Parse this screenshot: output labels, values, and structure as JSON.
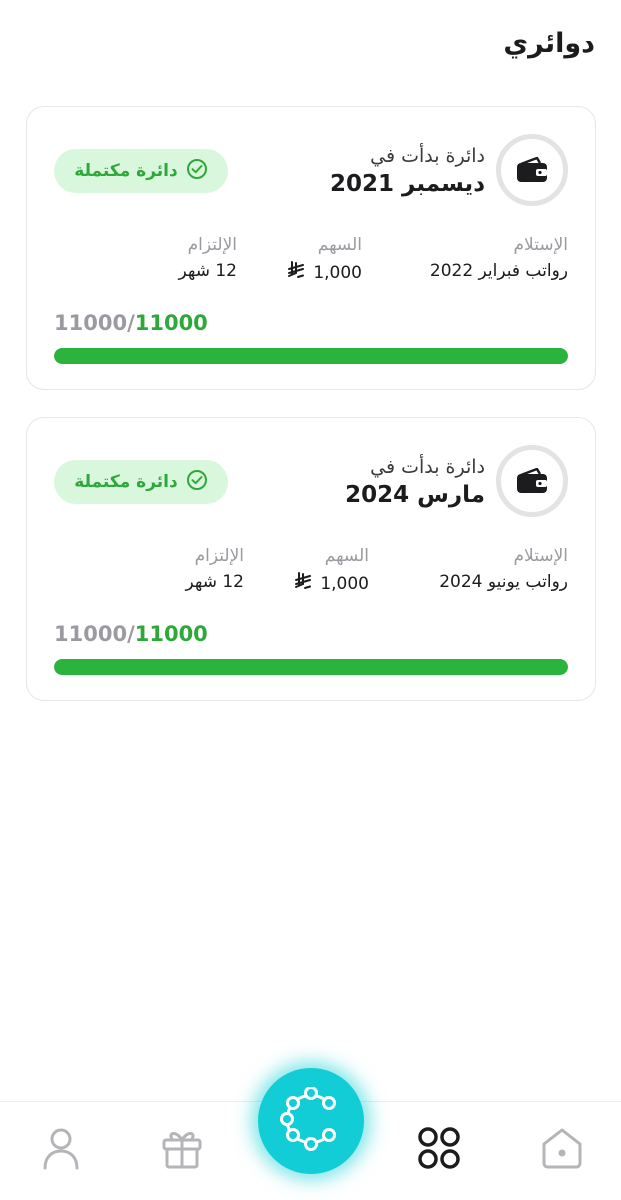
{
  "page_title": "دوائري",
  "circles": [
    {
      "start_label": "دائرة بدأت في",
      "start_date": "ديسمبر 2021",
      "status": "دائرة مكتملة",
      "receive_label": "الإستلام",
      "receive_value": "رواتب فبراير 2022",
      "share_label": "السهم",
      "share_value": "1,000",
      "commit_label": "الإلتزام",
      "commit_value": "12 شهر",
      "paid": "11000",
      "total": "11000",
      "progress": 1.0
    },
    {
      "start_label": "دائرة بدأت في",
      "start_date": "مارس 2024",
      "status": "دائرة مكتملة",
      "receive_label": "الإستلام",
      "receive_value": "رواتب يونيو 2024",
      "share_label": "السهم",
      "share_value": "1,000",
      "commit_label": "الإلتزام",
      "commit_value": "12 شهر",
      "paid": "11000",
      "total": "11000",
      "progress": 1.0
    }
  ],
  "icons": {
    "card": "wallet-icon",
    "status": "check-circle-icon",
    "currency": "riyal-symbol-icon"
  },
  "bottom_nav": {
    "items": [
      "home-icon",
      "circles-icon",
      "center-logo-icon",
      "gift-icon",
      "profile-icon"
    ],
    "active": "circles-icon"
  },
  "colors": {
    "accent_green": "#2bb33d",
    "badge_bg": "#d9f7dc",
    "fab_cyan": "#13cdd6"
  }
}
